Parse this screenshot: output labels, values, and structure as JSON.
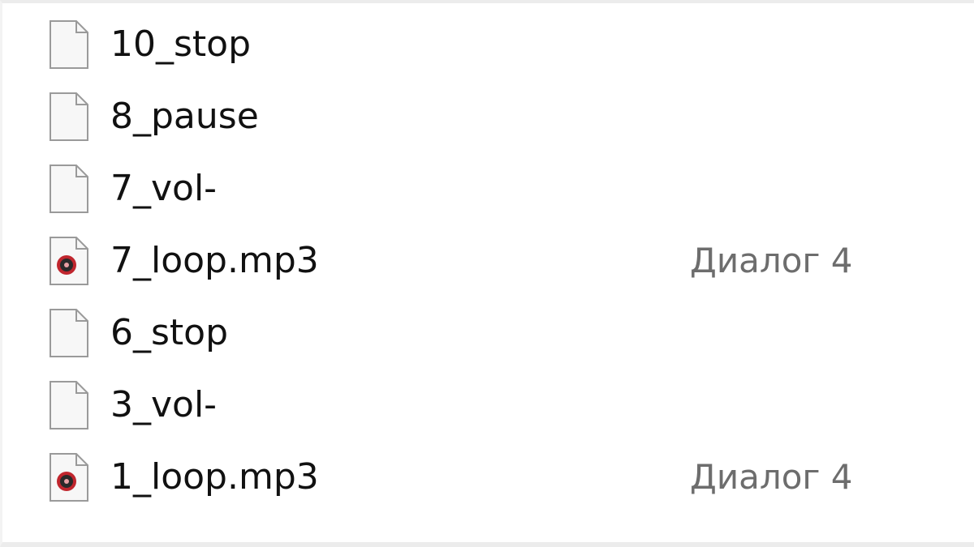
{
  "files": [
    {
      "name": "10_stop",
      "icon": "blank-file-icon",
      "album": ""
    },
    {
      "name": "8_pause",
      "icon": "blank-file-icon",
      "album": ""
    },
    {
      "name": "7_vol-",
      "icon": "blank-file-icon",
      "album": ""
    },
    {
      "name": "7_loop.mp3",
      "icon": "mp3-file-icon",
      "album": "Диалог 4"
    },
    {
      "name": "6_stop",
      "icon": "blank-file-icon",
      "album": ""
    },
    {
      "name": "3_vol-",
      "icon": "blank-file-icon",
      "album": ""
    },
    {
      "name": "1_loop.mp3",
      "icon": "mp3-file-icon",
      "album": "Диалог 4"
    }
  ],
  "colors": {
    "icon_stroke": "#9a9a9a",
    "icon_fill": "#f7f7f7",
    "disc_outer": "#c0262e",
    "disc_inner": "#2a2a2a"
  }
}
